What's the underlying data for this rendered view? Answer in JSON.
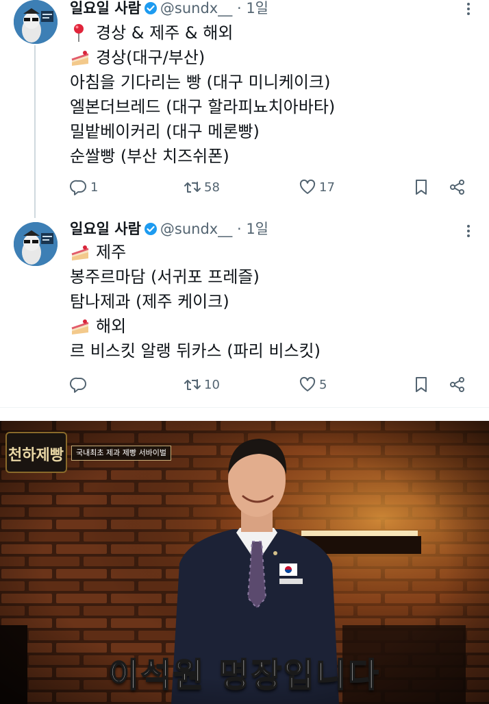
{
  "tweets": [
    {
      "display_name": "일요일 사람",
      "handle": "@sundx__",
      "separator": "·",
      "time": "1일",
      "lines": [
        {
          "emoji": "pin-emoji",
          "text": "경상 & 제주 & 해외"
        },
        {
          "emoji": "cake-emoji",
          "text": "경상(대구/부산)"
        },
        {
          "emoji": "",
          "text": "아침을 기다리는 빵 (대구 미니케이크)"
        },
        {
          "emoji": "",
          "text": "엘본더브레드 (대구 할라피뇨치아바타)"
        },
        {
          "emoji": "",
          "text": "밀밭베이커리 (대구 메론빵)"
        },
        {
          "emoji": "",
          "text": "순쌀빵 (부산 치즈쉬폰)"
        }
      ],
      "actions": {
        "replies": "1",
        "retweets": "58",
        "likes": "17"
      }
    },
    {
      "display_name": "일요일 사람",
      "handle": "@sundx__",
      "separator": "·",
      "time": "1일",
      "lines": [
        {
          "emoji": "cake-emoji",
          "text": "제주"
        },
        {
          "emoji": "",
          "text": "봉주르마담 (서귀포 프레즐)"
        },
        {
          "emoji": "",
          "text": "탐나제과 (제주 케이크)"
        },
        {
          "emoji": "cake-emoji",
          "text": "해외"
        },
        {
          "emoji": "",
          "text": "르 비스킷 알랭 뒤카스 (파리 비스킷)"
        }
      ],
      "actions": {
        "replies": "",
        "retweets": "10",
        "likes": "5"
      }
    }
  ],
  "video": {
    "logo_text": "천하제빵",
    "program_title": "국내최초 제과 제빵 서바이벌",
    "subtitle": "이석원 명장입니다"
  },
  "colors": {
    "verified": "#1d9bf0",
    "muted": "#536471",
    "text": "#0f1419"
  }
}
